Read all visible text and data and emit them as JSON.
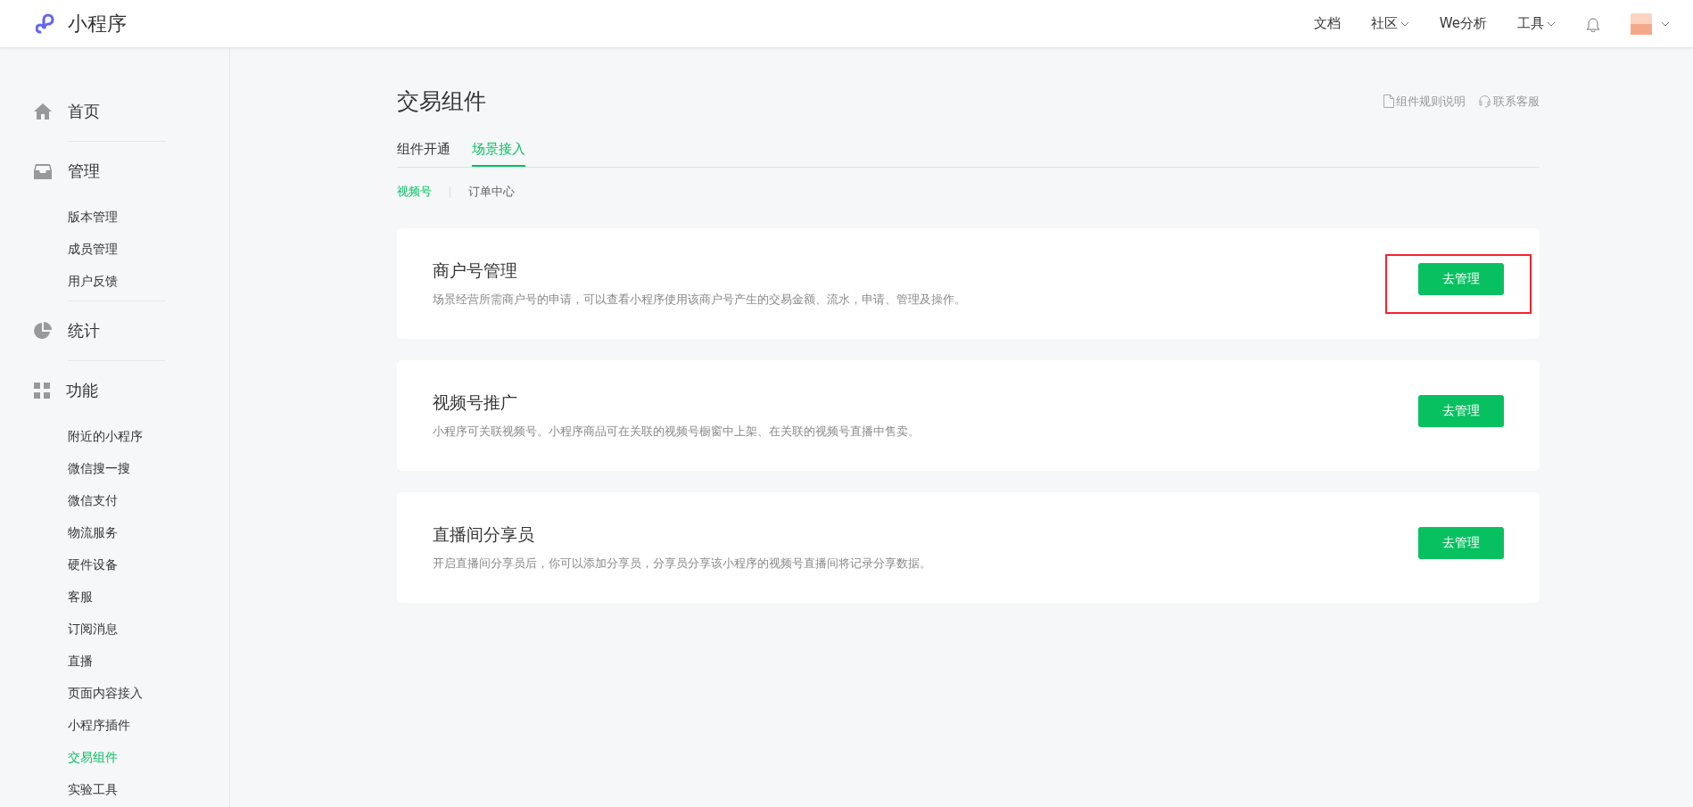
{
  "topbar": {
    "logo_text": "小程序",
    "nav": [
      {
        "label": "文档",
        "dropdown": false
      },
      {
        "label": "社区",
        "dropdown": true
      },
      {
        "label": "We分析",
        "dropdown": false
      },
      {
        "label": "工具",
        "dropdown": true
      }
    ]
  },
  "sidebar": {
    "sections": [
      {
        "kind": "home",
        "title": "首页"
      },
      {
        "kind": "manage",
        "title": "管理",
        "items": [
          {
            "label": "版本管理",
            "selected": false
          },
          {
            "label": "成员管理",
            "selected": false
          },
          {
            "label": "用户反馈",
            "selected": false
          }
        ]
      },
      {
        "kind": "stats",
        "title": "统计"
      },
      {
        "kind": "features",
        "title": "功能",
        "items": [
          {
            "label": "附近的小程序",
            "selected": false
          },
          {
            "label": "微信搜一搜",
            "selected": false
          },
          {
            "label": "微信支付",
            "selected": false
          },
          {
            "label": "物流服务",
            "selected": false
          },
          {
            "label": "硬件设备",
            "selected": false
          },
          {
            "label": "客服",
            "selected": false
          },
          {
            "label": "订阅消息",
            "selected": false
          },
          {
            "label": "直播",
            "selected": false
          },
          {
            "label": "页面内容接入",
            "selected": false
          },
          {
            "label": "小程序插件",
            "selected": false
          },
          {
            "label": "交易组件",
            "selected": true
          },
          {
            "label": "实验工具",
            "selected": false
          }
        ]
      }
    ]
  },
  "page": {
    "title": "交易组件",
    "links": [
      {
        "kind": "doc",
        "label": "组件规则说明"
      },
      {
        "kind": "support",
        "label": "联系客服"
      }
    ],
    "tabs": [
      {
        "label": "组件开通",
        "selected": false
      },
      {
        "label": "场景接入",
        "selected": true
      }
    ],
    "subtabs": [
      {
        "label": "视频号",
        "selected": true
      },
      {
        "label": "订单中心",
        "selected": false
      }
    ],
    "cards": [
      {
        "title": "商户号管理",
        "description": "场景经营所需商户号的申请，可以查看小程序使用该商户号产生的交易金额、流水，申请、管理及操作。",
        "button": "去管理",
        "highlighted": true
      },
      {
        "title": "视频号推广",
        "description": "小程序可关联视频号。小程序商品可在关联的视频号橱窗中上架、在关联的视频号直播中售卖。",
        "button": "去管理",
        "highlighted": false
      },
      {
        "title": "直播间分享员",
        "description": "开启直播间分享员后，你可以添加分享员，分享员分享该小程序的视频号直播间将记录分享数据。",
        "button": "去管理",
        "highlighted": false
      }
    ]
  }
}
